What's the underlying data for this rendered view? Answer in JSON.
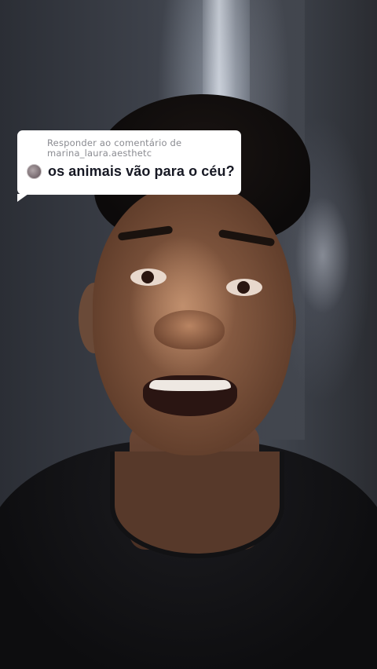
{
  "reply_sticker": {
    "header_line1": "Responder ao comentário de",
    "header_line2": "marina_laura.aesthetc",
    "comment_text": "os animais vão para o céu?",
    "avatar_icon": "user-avatar-icon"
  },
  "colors": {
    "bubble_background": "#ffffff",
    "header_text": "#8a8b91",
    "comment_text": "#161823"
  }
}
